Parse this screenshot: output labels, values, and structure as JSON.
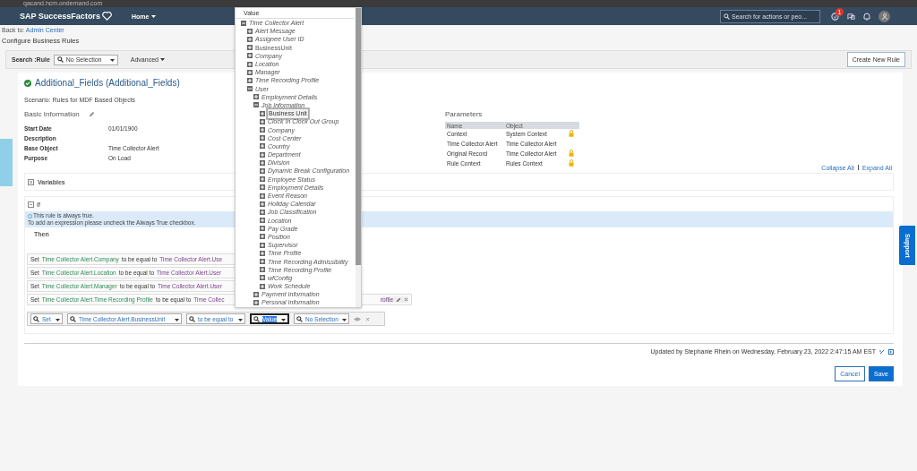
{
  "browser": {
    "address": "qacand.hcm.ondemand.com"
  },
  "header": {
    "logo": "SAP SuccessFactors",
    "home": "Home",
    "search": {
      "placeholder": "Search for actions or peo..."
    },
    "notification_count": "1"
  },
  "breadcrumb": {
    "prefix": "Back to:",
    "link": "Admin Center"
  },
  "page_title": "Configure Business Rules",
  "search_bar": {
    "label": "Search :Rule",
    "select": "No Selection",
    "advanced": "Advanced",
    "create_button": "Create New Rule"
  },
  "rule": {
    "title": "Additional_Fields (Additional_Fields)",
    "scenario": "Scenario: Rules for MDF Based Objects"
  },
  "basic_info": {
    "title": "Basic Information",
    "fields": [
      {
        "label": "Start Date",
        "value": "01/01/1900"
      },
      {
        "label": "Description"
      },
      {
        "label": "Base Object",
        "value": "Time Collector Alert"
      },
      {
        "label": "Purpose",
        "value": "On Load"
      }
    ]
  },
  "parameters": {
    "title": "Parameters",
    "columns": [
      "Name",
      "Object"
    ],
    "rows": [
      {
        "name": "Context",
        "object": "System Context",
        "locked": true
      },
      {
        "name": "Time Collector Alert",
        "object": "Time Collector Alert",
        "locked": false
      },
      {
        "name": "Original Record",
        "object": "Time Collector Alert",
        "locked": true
      },
      {
        "name": "Rule Context",
        "object": "Rules Context",
        "locked": true
      }
    ]
  },
  "links": [
    "Collapse All",
    "Expand All"
  ],
  "variables": {
    "label": "Variables",
    "expanded": false
  },
  "if_section": {
    "label": "If",
    "expanded": true,
    "notice": [
      "This rule is always true.",
      "To add an expression please uncheck the Always True checkbox."
    ]
  },
  "then": {
    "label": "Then",
    "statements": [
      {
        "verb": "Set",
        "target": "Time Collector Alert.Company",
        "op": "to be equal to",
        "value": "Time Collector Alert.Use"
      },
      {
        "verb": "Set",
        "target": "Time Collector Alert.Location",
        "op": "to be equal to",
        "value": "Time Collector Alert.User"
      },
      {
        "verb": "Set",
        "target": "Time Collector Alert.Manager",
        "op": "to be equal to",
        "value": "Time Collector Alert.User"
      },
      {
        "verb": "Set",
        "target": "Time Collector Alert.Time Recording Profile",
        "op": "to be equal to",
        "value": "Time Collec",
        "value_tail": "rofile"
      }
    ],
    "editor": [
      {
        "text": "Set",
        "selected": false
      },
      {
        "text": "Time Collector Alert.BusinessUnit",
        "selected": false
      },
      {
        "text": "to be equal to",
        "selected": false
      },
      {
        "text": "Value",
        "selected": true
      },
      {
        "text": "No Selection",
        "selected": false
      }
    ]
  },
  "dropdown": {
    "header": "Value",
    "tree": [
      {
        "label": "Time Collector Alert",
        "kind": "field",
        "expanded": true,
        "selected": false,
        "children": [
          {
            "label": "Alert Message",
            "kind": "field",
            "expanded": false,
            "selected": false
          },
          {
            "label": "Assignee User ID",
            "kind": "field",
            "expanded": false,
            "selected": false
          },
          {
            "label": "BusinessUnit",
            "kind": "key",
            "expanded": false,
            "selected": false
          },
          {
            "label": "Company",
            "kind": "field",
            "expanded": false,
            "selected": false
          },
          {
            "label": "Location",
            "kind": "field",
            "expanded": false,
            "selected": false
          },
          {
            "label": "Manager",
            "kind": "field",
            "expanded": false,
            "selected": false
          },
          {
            "label": "Time Recording Profile",
            "kind": "field",
            "expanded": false,
            "selected": false
          },
          {
            "label": "User",
            "kind": "field",
            "expanded": true,
            "selected": false,
            "children": [
              {
                "label": "Employment Details",
                "kind": "field",
                "expanded": false,
                "selected": false
              },
              {
                "label": "Job Information",
                "kind": "field",
                "expanded": true,
                "selected": false,
                "children": [
                  {
                    "label": "Business Unit",
                    "kind": "key",
                    "expanded": false,
                    "selected": true
                  },
                  {
                    "label": "Clock In Clock Out Group",
                    "kind": "field",
                    "expanded": false,
                    "selected": false
                  },
                  {
                    "label": "Company",
                    "kind": "field",
                    "expanded": false,
                    "selected": false
                  },
                  {
                    "label": "Cost Center",
                    "kind": "field",
                    "expanded": false,
                    "selected": false
                  },
                  {
                    "label": "Country",
                    "kind": "field",
                    "expanded": false,
                    "selected": false
                  },
                  {
                    "label": "Department",
                    "kind": "field",
                    "expanded": false,
                    "selected": false
                  },
                  {
                    "label": "Division",
                    "kind": "field",
                    "expanded": false,
                    "selected": false
                  },
                  {
                    "label": "Dynamic Break Configuration",
                    "kind": "field",
                    "expanded": false,
                    "selected": false
                  },
                  {
                    "label": "Employee Status",
                    "kind": "field",
                    "expanded": false,
                    "selected": false
                  },
                  {
                    "label": "Employment Details",
                    "kind": "field",
                    "expanded": false,
                    "selected": false
                  },
                  {
                    "label": "Event Reason",
                    "kind": "field",
                    "expanded": false,
                    "selected": false
                  },
                  {
                    "label": "Holiday Calendar",
                    "kind": "field",
                    "expanded": false,
                    "selected": false
                  },
                  {
                    "label": "Job Classification",
                    "kind": "field",
                    "expanded": false,
                    "selected": false
                  },
                  {
                    "label": "Location",
                    "kind": "field",
                    "expanded": false,
                    "selected": false
                  },
                  {
                    "label": "Pay Grade",
                    "kind": "field",
                    "expanded": false,
                    "selected": false
                  },
                  {
                    "label": "Position",
                    "kind": "field",
                    "expanded": false,
                    "selected": false
                  },
                  {
                    "label": "Supervisor",
                    "kind": "field",
                    "expanded": false,
                    "selected": false
                  },
                  {
                    "label": "Time Profile",
                    "kind": "field",
                    "expanded": false,
                    "selected": false
                  },
                  {
                    "label": "Time Recording Admissibility",
                    "kind": "field",
                    "expanded": false,
                    "selected": false
                  },
                  {
                    "label": "Time Recording Profile",
                    "kind": "field",
                    "expanded": false,
                    "selected": false
                  },
                  {
                    "label": "wfConfig",
                    "kind": "field",
                    "expanded": false,
                    "selected": false
                  },
                  {
                    "label": "Work Schedule",
                    "kind": "field",
                    "expanded": false,
                    "selected": false
                  }
                ]
              },
              {
                "label": "Payment Information",
                "kind": "field",
                "expanded": false,
                "selected": false
              },
              {
                "label": "Personal Information",
                "kind": "field",
                "expanded": false,
                "selected": false
              }
            ]
          }
        ]
      }
    ]
  },
  "footer": {
    "updated": "Updated by Stephanie Rhein on Wednesday, February 23, 2022 2:47:15 AM EST",
    "buttons": [
      {
        "label": "Cancel",
        "kind": "secondary"
      },
      {
        "label": "Save",
        "kind": "primary"
      }
    ]
  },
  "support_tab": "Support"
}
